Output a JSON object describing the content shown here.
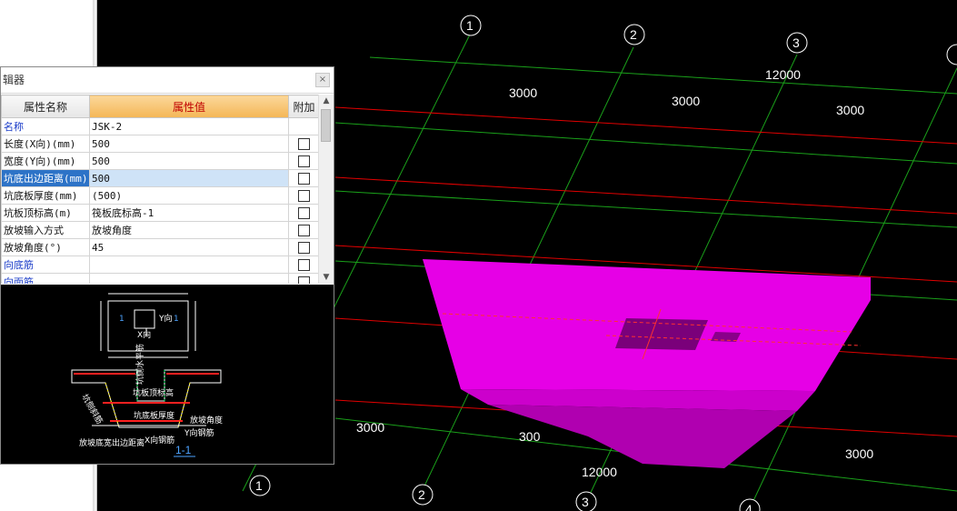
{
  "panel": {
    "title": "辑器",
    "close_icon": "close-icon",
    "headers": {
      "name": "属性名称",
      "value": "属性值",
      "extra": "附加"
    },
    "rows": [
      {
        "name": "名称",
        "value": "JSK-2",
        "blue": true,
        "has_checkbox": false,
        "checked": false,
        "selected": false
      },
      {
        "name": "长度(X向)(mm)",
        "value": "500",
        "blue": false,
        "has_checkbox": true,
        "checked": false,
        "selected": false
      },
      {
        "name": "宽度(Y向)(mm)",
        "value": "500",
        "blue": false,
        "has_checkbox": true,
        "checked": false,
        "selected": false
      },
      {
        "name": "坑底出边距离(mm)",
        "value": "500",
        "blue": false,
        "has_checkbox": true,
        "checked": false,
        "selected": true
      },
      {
        "name": "坑底板厚度(mm)",
        "value": "(500)",
        "blue": false,
        "has_checkbox": true,
        "checked": false,
        "selected": false
      },
      {
        "name": "坑板顶标高(m)",
        "value": "筏板底标高-1",
        "blue": false,
        "has_checkbox": true,
        "checked": false,
        "selected": false
      },
      {
        "name": "放坡输入方式",
        "value": "放坡角度",
        "blue": false,
        "has_checkbox": true,
        "checked": false,
        "selected": false
      },
      {
        "name": "放坡角度(°)",
        "value": "45",
        "blue": false,
        "has_checkbox": true,
        "checked": false,
        "selected": false
      },
      {
        "name": "向底筋",
        "value": "",
        "blue": true,
        "has_checkbox": true,
        "checked": false,
        "selected": false
      },
      {
        "name": "向面筋",
        "value": "",
        "blue": true,
        "has_checkbox": true,
        "checked": false,
        "selected": false
      }
    ],
    "scrollbar": {
      "up_icon": "arrow-up-icon",
      "down_icon": "arrow-down-icon"
    }
  },
  "diagram": {
    "top_x_label": "X向",
    "top_y_label": "Y向",
    "section_marker": "1",
    "labels": {
      "wall_label": "坑侧水平筋",
      "top_elev": "坑板顶标高",
      "slab_thickness": "坑底板厚度",
      "slope_angle": "放坡角度",
      "y_bar": "Y向钢筋",
      "x_bar": "X向钢筋",
      "edge_dist": "放坡底宽出边距离",
      "side_label": "坑侧斜筋"
    },
    "section_title": "1-1"
  },
  "viewport": {
    "axes": {
      "bubbles": [
        "1",
        "2",
        "3",
        "1",
        "2",
        "3",
        "4"
      ],
      "dims": [
        "3000",
        "3000",
        "12000",
        "3000",
        "3000",
        "300",
        "12000",
        "3000"
      ]
    },
    "colors": {
      "pit": "#e600e6",
      "grid_red": "#e00000",
      "grid_green": "#1aa01a",
      "bg": "#000000"
    }
  }
}
